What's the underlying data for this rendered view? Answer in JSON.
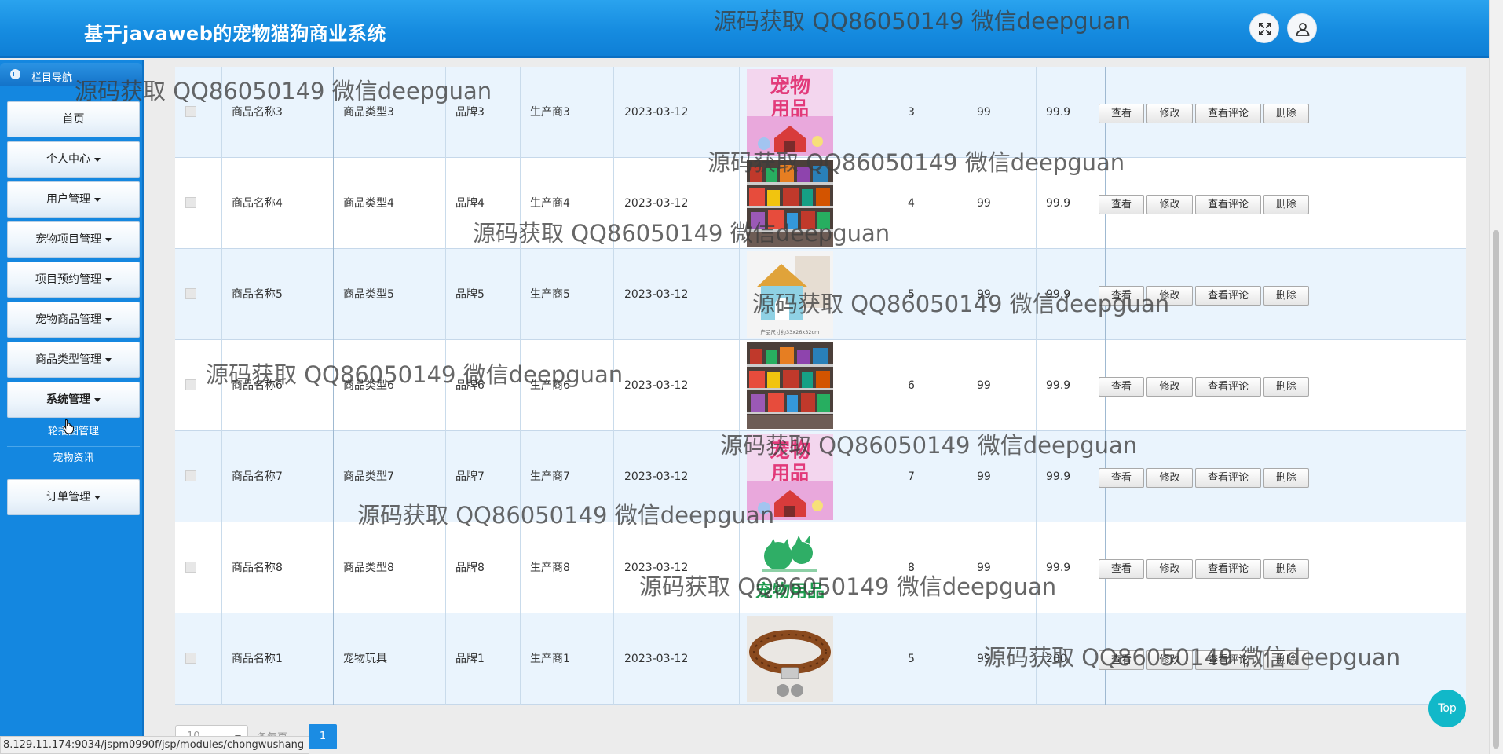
{
  "header": {
    "title": "基于javaweb的宠物猫狗商业系统"
  },
  "sidebar": {
    "title": "栏目导航",
    "items": [
      {
        "label": "首页",
        "has_caret": false
      },
      {
        "label": "个人中心",
        "has_caret": true
      },
      {
        "label": "用户管理",
        "has_caret": true
      },
      {
        "label": "宠物项目管理",
        "has_caret": true
      },
      {
        "label": "项目预约管理",
        "has_caret": true
      },
      {
        "label": "宠物商品管理",
        "has_caret": true
      },
      {
        "label": "商品类型管理",
        "has_caret": true
      },
      {
        "label": "系统管理",
        "has_caret": true
      },
      {
        "label": "订单管理",
        "has_caret": true
      }
    ],
    "submenu": [
      "轮播图管理",
      "宠物资讯"
    ]
  },
  "table": {
    "rows": [
      {
        "name": "商品名称3",
        "type": "商品类型3",
        "brand": "品牌3",
        "maker": "生产商3",
        "date": "2023-03-12",
        "image": "pet-supplies-pink",
        "c1": "3",
        "c2": "99",
        "c3": "99.9"
      },
      {
        "name": "商品名称4",
        "type": "商品类型4",
        "brand": "品牌4",
        "maker": "生产商4",
        "date": "2023-03-12",
        "image": "pet-store-shelf",
        "c1": "4",
        "c2": "99",
        "c3": "99.9"
      },
      {
        "name": "商品名称5",
        "type": "商品类型5",
        "brand": "品牌5",
        "maker": "生产商5",
        "date": "2023-03-12",
        "image": "pet-house",
        "c1": "5",
        "c2": "99",
        "c3": "99.9"
      },
      {
        "name": "商品名称6",
        "type": "商品类型6",
        "brand": "品牌6",
        "maker": "生产商6",
        "date": "2023-03-12",
        "image": "pet-store-shelf",
        "c1": "6",
        "c2": "99",
        "c3": "99.9"
      },
      {
        "name": "商品名称7",
        "type": "商品类型7",
        "brand": "品牌7",
        "maker": "生产商7",
        "date": "2023-03-12",
        "image": "pet-supplies-pink",
        "c1": "7",
        "c2": "99",
        "c3": "99.9"
      },
      {
        "name": "商品名称8",
        "type": "商品类型8",
        "brand": "品牌8",
        "maker": "生产商8",
        "date": "2023-03-12",
        "image": "pet-supplies-green",
        "c1": "8",
        "c2": "99",
        "c3": "99.9"
      },
      {
        "name": "商品名称1",
        "type": "宠物玩具",
        "brand": "品牌1",
        "maker": "生产商1",
        "date": "2023-03-12",
        "image": "pet-collar",
        "c1": "5",
        "c2": "99",
        "c3": "200"
      }
    ],
    "actions": [
      "查看",
      "修改",
      "查看评论",
      "删除"
    ]
  },
  "image_texts": {
    "supplies_1": "宠物",
    "supplies_2": "用品",
    "green_1": "宠物用品",
    "house_caption": "产品尺寸约33x26x32cm"
  },
  "pager": {
    "page_size": "10",
    "per_page_label": "条每页",
    "current_page": "1"
  },
  "status_url": "8.129.11.174:9034/jspm0990f/jsp/modules/chongwushang",
  "top_button": "Top",
  "watermark": "源码获取 QQ86050149 微信deepguan",
  "colors": {
    "header": "#168ce0",
    "sidebar": "#1487e0",
    "row_odd": "#eaf4fd",
    "pager_active": "#1b8ce3",
    "top_button": "#11b8c9"
  }
}
